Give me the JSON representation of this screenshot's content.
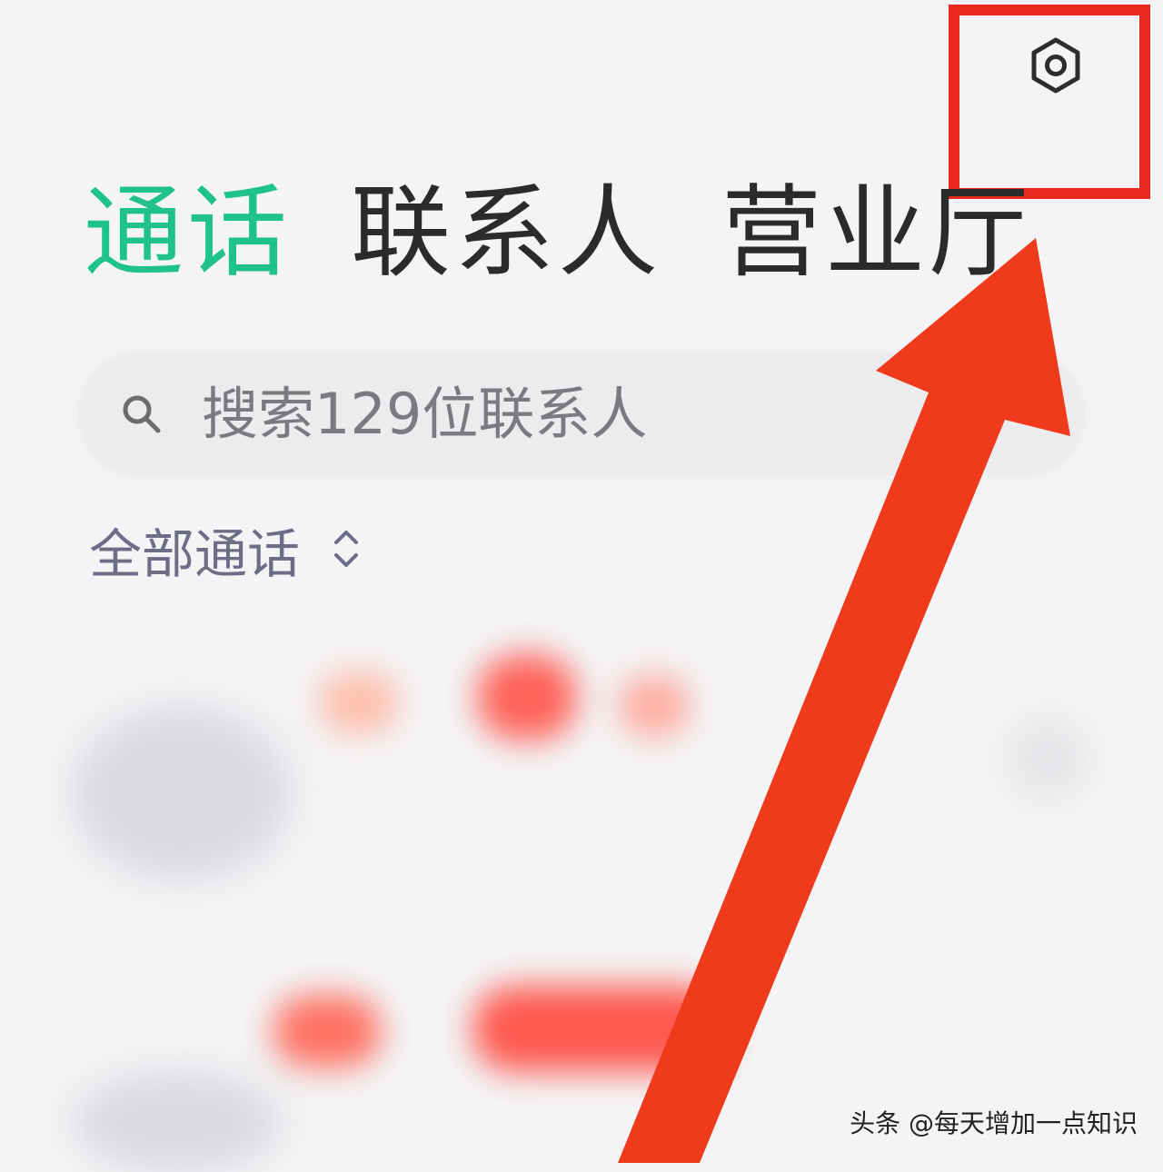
{
  "header": {
    "settings_icon": "settings-icon"
  },
  "tabs": [
    {
      "label": "通话",
      "active": true
    },
    {
      "label": "联系人",
      "active": false
    },
    {
      "label": "营业厅",
      "active": false
    }
  ],
  "search": {
    "placeholder": "搜索129位联系人",
    "icon": "search-icon"
  },
  "filter": {
    "label": "全部通话",
    "icon": "sort-icon"
  },
  "watermark": "头条 @每天增加一点知识",
  "colors": {
    "active_tab": "#1fc28a",
    "accent_red": "#e8291f",
    "text_primary": "#2b2b2b",
    "text_secondary": "#6d6d86"
  }
}
